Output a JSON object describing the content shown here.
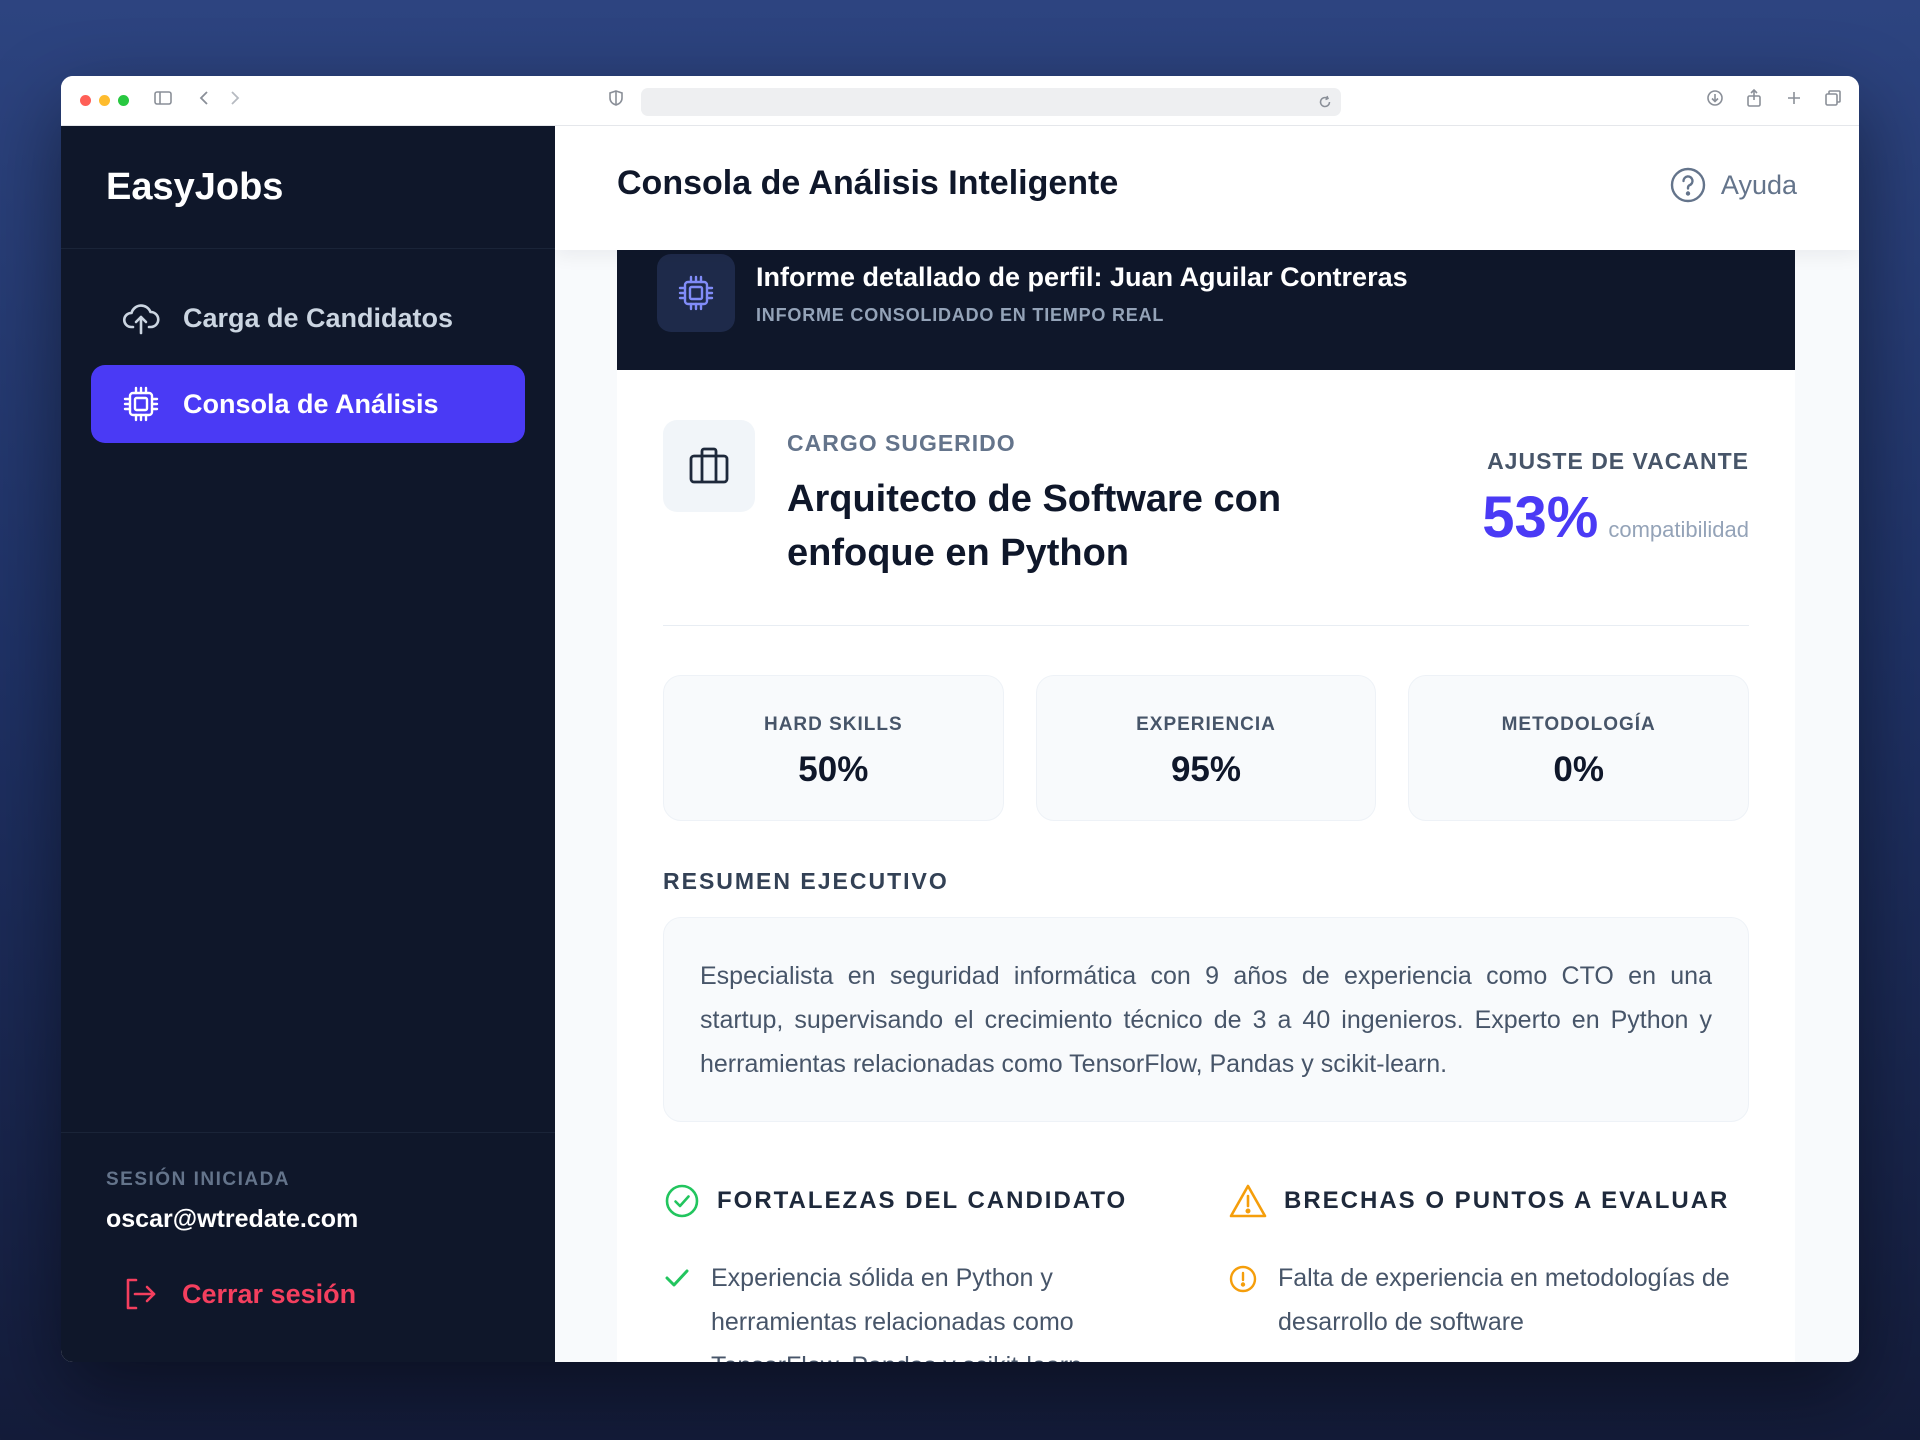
{
  "sidebar": {
    "brand": "EasyJobs",
    "items": [
      {
        "label": "Carga de Candidatos",
        "icon": "cloud-upload-icon"
      },
      {
        "label": "Consola de Análisis",
        "icon": "cpu-chip-icon",
        "active": true
      }
    ],
    "session_label": "SESIÓN INICIADA",
    "session_email": "oscar@wtredate.com",
    "logout_label": "Cerrar sesión"
  },
  "header": {
    "title": "Consola de Análisis Inteligente",
    "help_label": "Ayuda"
  },
  "report": {
    "title": "Informe detallado de perfil: Juan Aguilar Contreras",
    "subtitle": "INFORME CONSOLIDADO EN TIEMPO REAL",
    "role_label": "CARGO SUGERIDO",
    "role_name": "Arquitecto de Software con enfoque en Python",
    "fit_label": "AJUSTE DE VACANTE",
    "fit_value": "53%",
    "fit_unit": "compatibilidad",
    "metrics": [
      {
        "label": "HARD SKILLS",
        "value": "50%"
      },
      {
        "label": "EXPERIENCIA",
        "value": "95%"
      },
      {
        "label": "METODOLOGÍA",
        "value": "0%"
      }
    ],
    "summary_title": "RESUMEN EJECUTIVO",
    "summary_text": "Especialista en seguridad informática con 9 años de experiencia como CTO en una startup, supervisando el crecimiento técnico de 3 a 40 ingenieros. Experto en Python y herramientas relacionadas como TensorFlow, Pandas y scikit-learn.",
    "strengths_title": "FORTALEZAS DEL CANDIDATO",
    "strengths": [
      "Experiencia sólida en Python y herramientas relacionadas como TensorFlow, Pandas y scikit-learn"
    ],
    "gaps_title": "BRECHAS O PUNTOS A EVALUAR",
    "gaps": [
      "Falta de experiencia en metodologías de desarrollo de software"
    ]
  },
  "colors": {
    "accent": "#4a3af5",
    "sidebar_bg": "#0f172a",
    "success": "#22c55e",
    "warning": "#f59e0b",
    "danger": "#f43f5e"
  }
}
